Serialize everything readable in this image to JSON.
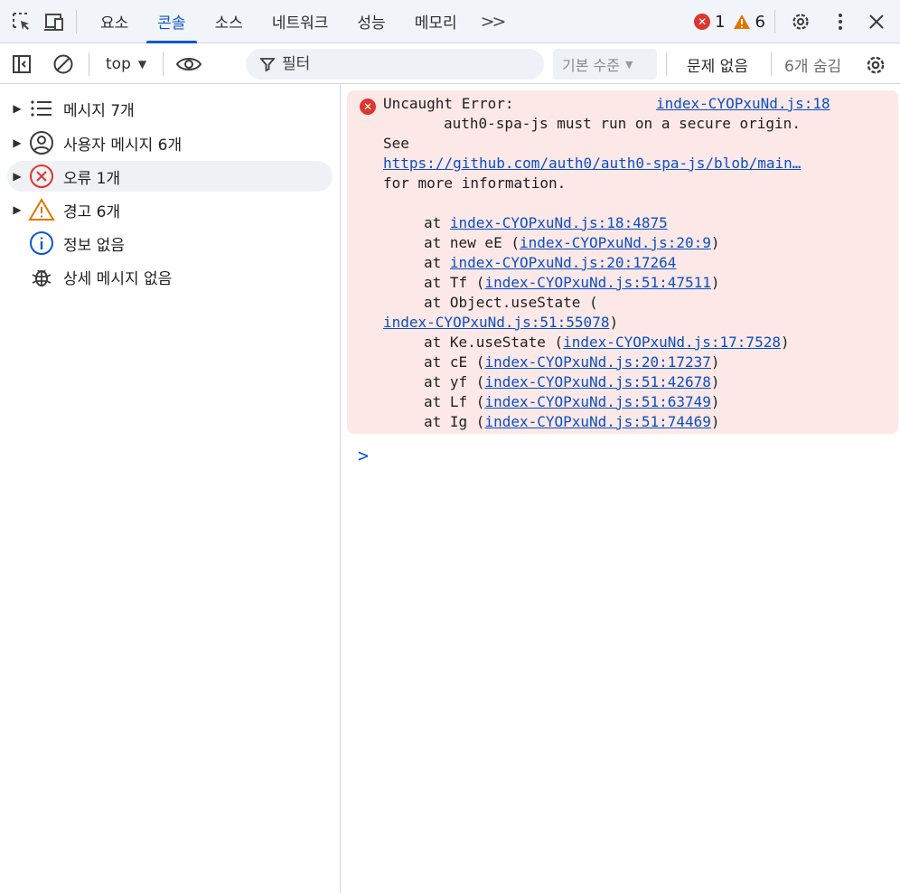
{
  "tabbar": {
    "tabs": [
      "요소",
      "콘솔",
      "소스",
      "네트워크",
      "성능",
      "메모리"
    ],
    "active_tab": "콘솔",
    "more_label": ">>",
    "error_count": "1",
    "warning_count": "6",
    "icons": [
      "inspect-element-icon",
      "device-toolbar-icon",
      "settings-gear-icon",
      "more-vert-icon",
      "close-icon"
    ]
  },
  "toolbar": {
    "context": "top",
    "filter_label": "필터",
    "level": "기본 수준",
    "issues": "문제 없음",
    "hidden_count": "6개 숨김"
  },
  "sidebar": {
    "items": [
      {
        "label": "메시지 7개",
        "icon": "list-icon",
        "expandable": true
      },
      {
        "label": "사용자 메시지 6개",
        "icon": "user-icon",
        "expandable": true
      },
      {
        "label": "오류 1개",
        "icon": "error-icon",
        "expandable": true
      },
      {
        "label": "경고 6개",
        "icon": "warning-icon",
        "expandable": true
      },
      {
        "label": "정보 없음",
        "icon": "info-icon",
        "expandable": false
      },
      {
        "label": "상세 메시지 없음",
        "icon": "bug-icon",
        "expandable": false
      }
    ],
    "selected_index": 2
  },
  "console": {
    "error": {
      "title": "Uncaught Error:",
      "source_link": "index-CYOPxuNd.js:18",
      "message": "auth0-spa-js must run on a secure origin.",
      "see": "See",
      "url": "https://github.com/auth0/auth0-spa-js/blob/main…",
      "for_more": "for more information.",
      "stack": [
        {
          "prefix": "at ",
          "link": "index-CYOPxuNd.js:18:4875",
          "paren": false
        },
        {
          "prefix": "at new eE ",
          "link": "index-CYOPxuNd.js:20:9",
          "paren": true
        },
        {
          "prefix": "at ",
          "link": "index-CYOPxuNd.js:20:17264",
          "paren": false
        },
        {
          "prefix": "at Tf ",
          "link": "index-CYOPxuNd.js:51:47511",
          "paren": true
        },
        {
          "prefix": "at Object.useState (",
          "link": "index-CYOPxuNd.js:51:55078",
          "paren": false,
          "wrapped": true
        },
        {
          "prefix": "at Ke.useState ",
          "link": "index-CYOPxuNd.js:17:7528",
          "paren": true
        },
        {
          "prefix": "at cE ",
          "link": "index-CYOPxuNd.js:20:17237",
          "paren": true
        },
        {
          "prefix": "at yf ",
          "link": "index-CYOPxuNd.js:51:42678",
          "paren": true
        },
        {
          "prefix": "at Lf ",
          "link": "index-CYOPxuNd.js:51:63749",
          "paren": true
        },
        {
          "prefix": "at Ig ",
          "link": "index-CYOPxuNd.js:51:74469",
          "paren": true
        }
      ]
    },
    "prompt": ">"
  },
  "colors": {
    "accent": "#0b57d0",
    "error": "#dc362e",
    "warning": "#e37400",
    "error_bg": "#fce8e6",
    "link": "#0b4fc0"
  }
}
